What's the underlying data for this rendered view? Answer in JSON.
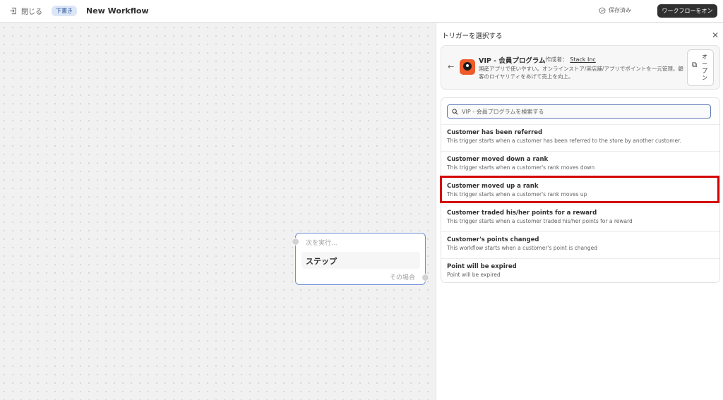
{
  "topbar": {
    "close_label": "閉じる",
    "status_badge": "下書き",
    "title": "New Workflow",
    "saved_label": "保存済み",
    "turn_on_label": "ワークフローをオン"
  },
  "canvas": {
    "step_hint": "次を実行...",
    "step_label": "ステップ",
    "step_else": "その場合"
  },
  "panel": {
    "title": "トリガーを選択する",
    "app": {
      "name": "VIP - 会員プログラム",
      "meta_prefix": "• 作成者：",
      "author": "Stack Inc",
      "description": "国産アプリで使いやすい。オンラインストア/実店舗/アプリでポイントを一元管理。顧客のロイヤリティをあげて売上を向上。",
      "open_label": "オープン"
    },
    "search": {
      "placeholder": "VIP - 会員プログラムを検索する",
      "value": ""
    },
    "triggers": [
      {
        "title": "Customer has been referred",
        "description": "This trigger starts when a customer has been referred to the store by another customer."
      },
      {
        "title": "Customer moved down a rank",
        "description": "This trigger starts when a customer's rank moves down"
      },
      {
        "title": "Customer moved up a rank",
        "description": "This trigger starts when a customer's rank moves up"
      },
      {
        "title": "Customer traded his/her points for a reward",
        "description": "This trigger starts when a customer traded his/her points for a reward"
      },
      {
        "title": "Customer's points changed",
        "description": "This workflow starts when a customer's point is changed"
      },
      {
        "title": "Point will be expired",
        "description": "Point will be expired"
      }
    ]
  },
  "colors": {
    "highlight": "#d40000",
    "primary_button": "#303030",
    "focus_border": "#5b79b8"
  }
}
